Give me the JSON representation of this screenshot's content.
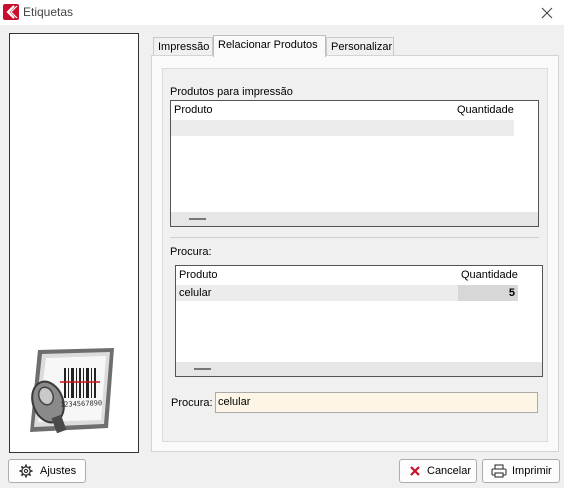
{
  "window": {
    "title": "Etiquetas",
    "brand_color": "#c8102e"
  },
  "tabs": [
    {
      "label": "Impressão"
    },
    {
      "label": "Relacionar Produtos"
    },
    {
      "label": "Personalizar"
    }
  ],
  "print_products": {
    "label": "Produtos para impressão",
    "columns": [
      "Produto",
      "Quantidade"
    ],
    "rows": []
  },
  "search_results": {
    "label": "Procura:",
    "columns": [
      "Produto",
      "Quantidade"
    ],
    "rows": [
      {
        "product": "celular",
        "quantity": "5"
      }
    ]
  },
  "search": {
    "label": "Procura:",
    "value": "celular"
  },
  "buttons": {
    "settings": "Ajustes",
    "cancel": "Cancelar",
    "print": "Imprimir"
  },
  "icons": {
    "app": "tag-logo-icon",
    "close": "close-icon",
    "settings": "gear-icon",
    "cancel": "x-icon",
    "print": "printer-icon"
  },
  "graphic": {
    "barcode_number": "1234567890"
  }
}
